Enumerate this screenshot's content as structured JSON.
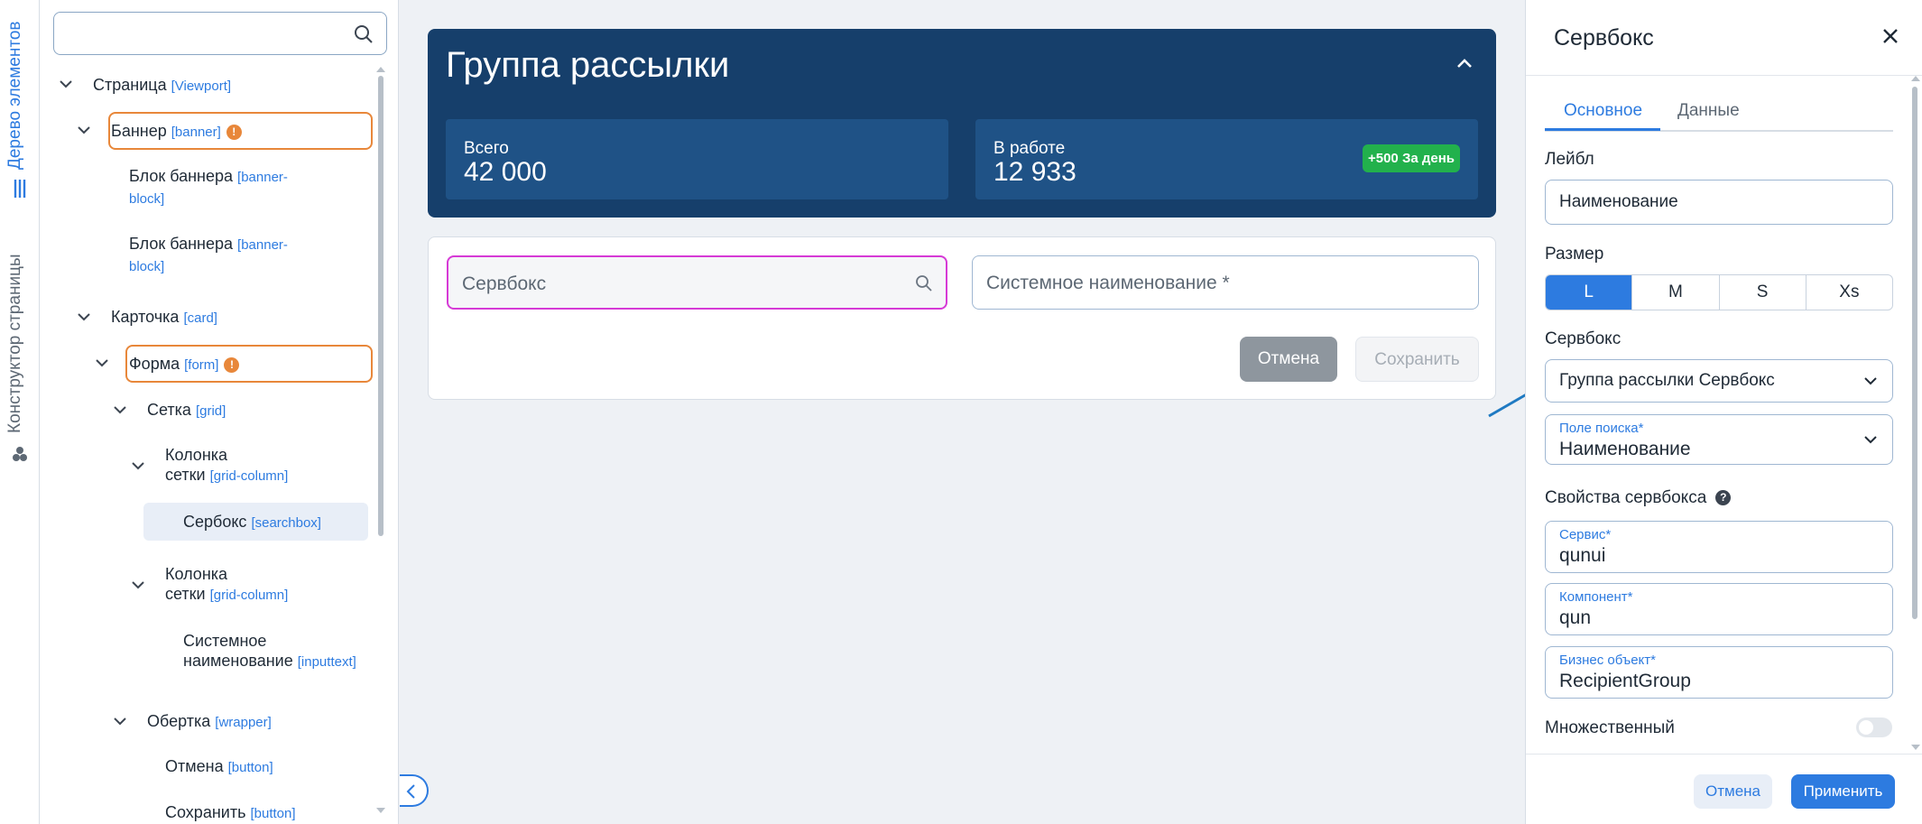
{
  "vertical_tabs": {
    "element_tree": "Дерево элементов",
    "page_builder": "Конструктор страницы"
  },
  "tree": {
    "search_placeholder": "",
    "nodes": [
      {
        "label": "Страница",
        "tag": "[Viewport]"
      },
      {
        "label": "Баннер",
        "tag": "[banner]"
      },
      {
        "label": "Блок баннера",
        "tag": "[banner-",
        "tag2": "block]"
      },
      {
        "label": "Блок баннера",
        "tag": "[banner-",
        "tag2": "block]"
      },
      {
        "label": "Карточка",
        "tag": "[card]"
      },
      {
        "label": "Форма",
        "tag": "[form]"
      },
      {
        "label": "Сетка",
        "tag": "[grid]"
      },
      {
        "label": "Колонка",
        "label2": "сетки",
        "tag": "[grid-column]"
      },
      {
        "label": "Сербокс",
        "tag": "[searchbox]"
      },
      {
        "label": "Колонка",
        "label2": "сетки",
        "tag": "[grid-column]"
      },
      {
        "label": "Системное",
        "label2": "наименование",
        "tag": "[inputtext]"
      },
      {
        "label": "Обертка",
        "tag": "[wrapper]"
      },
      {
        "label": "Отмена",
        "tag": "[button]"
      },
      {
        "label": "Сохранить",
        "tag": "[button]"
      }
    ],
    "warning_mark": "!"
  },
  "banner": {
    "title": "Группа рассылки",
    "stats": [
      {
        "label": "Всего",
        "value": "42 000"
      },
      {
        "label": "В работе",
        "value": "12 933",
        "badge": "+500 За день"
      }
    ]
  },
  "form": {
    "searchbox_placeholder": "Сервбокс",
    "system_name_placeholder": "Системное наименование *",
    "cancel": "Отмена",
    "save": "Сохранить"
  },
  "props": {
    "title": "Сервбокс",
    "tabs": [
      "Основное",
      "Данные"
    ],
    "label_section": "Лейбл",
    "label_value": "Наименование",
    "size_section": "Размер",
    "sizes": [
      "L",
      "M",
      "S",
      "Xs"
    ],
    "selected_size": "L",
    "searchbox_section": "Сервбокс",
    "searchbox_value": "Группа рассылки Сервбокс",
    "search_field_label": "Поле поиска*",
    "search_field_value": "Наименование",
    "properties_section": "Свойства сервбокса",
    "help_mark": "?",
    "service_label": "Сервис*",
    "service_value": "qunui",
    "component_label": "Компонент*",
    "component_value": "qun",
    "business_label": "Бизнес объект*",
    "business_value": "RecipientGroup",
    "multiple_label": "Множественный",
    "multiple_on": false,
    "cancel": "Отмена",
    "apply": "Применить"
  },
  "colors": {
    "accent": "#2d7be0",
    "banner": "#163f6b",
    "stat_bg": "#1f5286",
    "badge": "#22b14c",
    "highlight": "#e8873a",
    "searchbox_border": "#d63ad6"
  }
}
